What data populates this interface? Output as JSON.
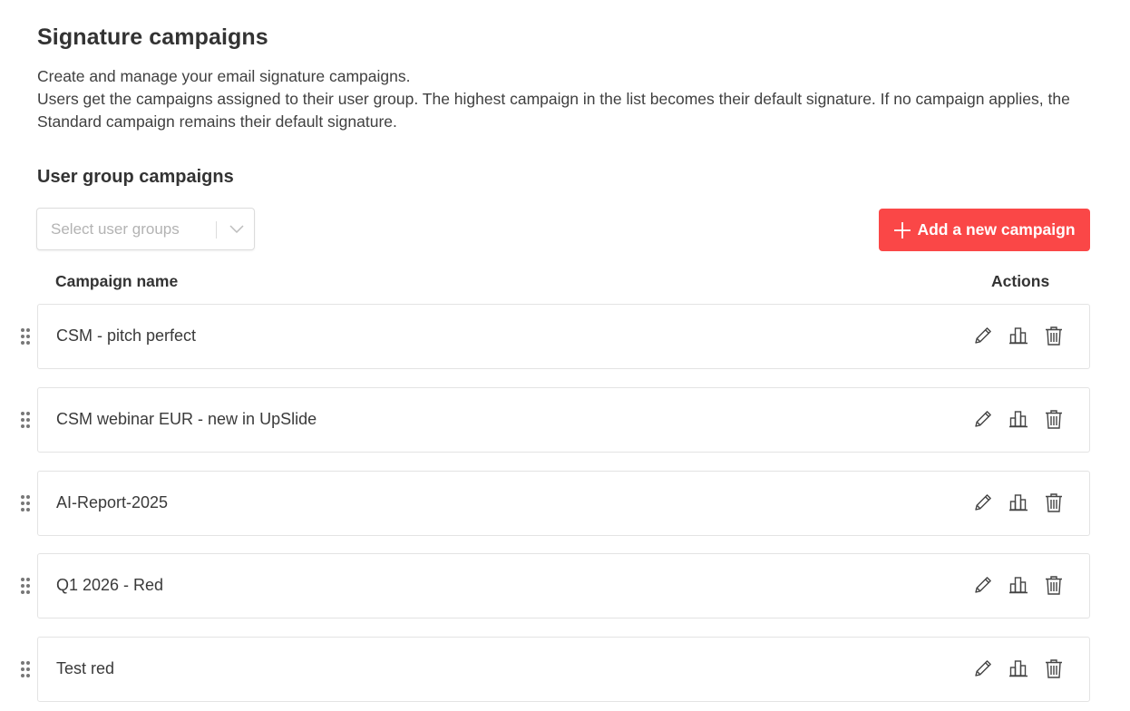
{
  "page": {
    "title": "Signature campaigns",
    "description_line1": "Create and manage your email signature campaigns.",
    "description_line2": "Users get the campaigns assigned to their user group. The highest campaign in the list becomes their default signature. If no campaign applies, the Standard campaign remains their default signature."
  },
  "section": {
    "title": "User group campaigns",
    "select_placeholder": "Select user groups",
    "add_button_label": "Add a new campaign"
  },
  "table": {
    "columns": {
      "name": "Campaign name",
      "actions": "Actions"
    },
    "rows": [
      {
        "name": "CSM - pitch perfect"
      },
      {
        "name": "CSM webinar EUR - new in UpSlide"
      },
      {
        "name": "AI-Report-2025"
      },
      {
        "name": "Q1 2026 - Red"
      },
      {
        "name": "Test red"
      }
    ]
  },
  "icons": {
    "drag": "drag-handle-icon",
    "edit": "pencil-icon",
    "stats": "bar-chart-icon",
    "delete": "trash-icon",
    "plus": "plus-icon",
    "chevron": "chevron-down-icon"
  },
  "colors": {
    "accent": "#fa4747",
    "text": "#333333",
    "border": "#e3e3e3",
    "placeholder": "#b3b3b3"
  }
}
